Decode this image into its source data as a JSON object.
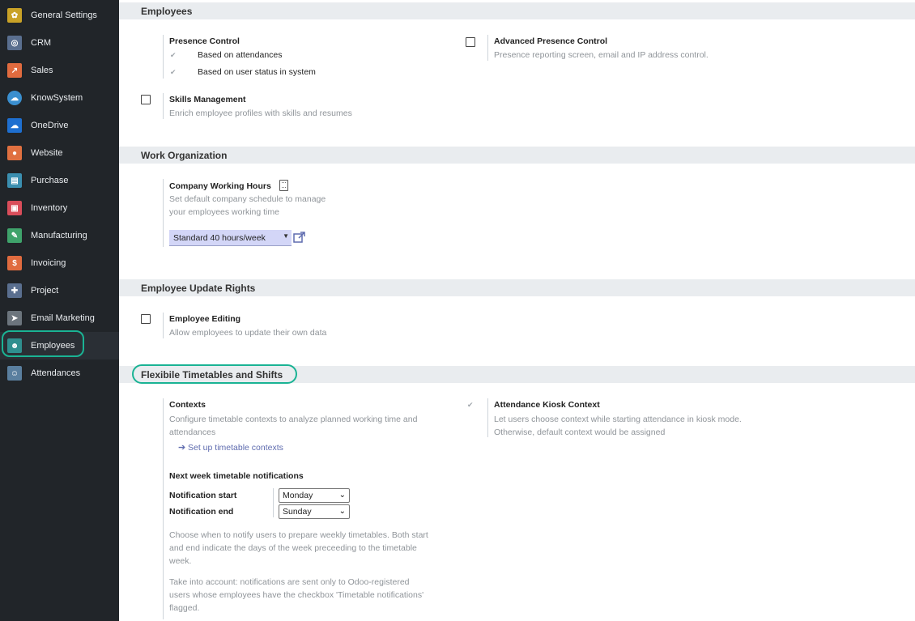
{
  "sidebar": {
    "items": [
      {
        "label": "General Settings",
        "icon": "gear-icon",
        "color": "#c9a227"
      },
      {
        "label": "CRM",
        "icon": "handshake-icon",
        "color": "#5a6f8f"
      },
      {
        "label": "Sales",
        "icon": "chart-icon",
        "color": "#e06b3f"
      },
      {
        "label": "KnowSystem",
        "icon": "cloud-icon",
        "color": "#3a8fcf"
      },
      {
        "label": "OneDrive",
        "icon": "onedrive-icon",
        "color": "#1e6fd0"
      },
      {
        "label": "Website",
        "icon": "globe-icon",
        "color": "#e07040"
      },
      {
        "label": "Purchase",
        "icon": "purchase-icon",
        "color": "#3b8fb0"
      },
      {
        "label": "Inventory",
        "icon": "inventory-icon",
        "color": "#d94d5a"
      },
      {
        "label": "Manufacturing",
        "icon": "wrench-icon",
        "color": "#3fa36b"
      },
      {
        "label": "Invoicing",
        "icon": "invoice-icon",
        "color": "#e06b3f"
      },
      {
        "label": "Project",
        "icon": "puzzle-icon",
        "color": "#5a6f8f"
      },
      {
        "label": "Email Marketing",
        "icon": "paper-plane-icon",
        "color": "#6c757d"
      },
      {
        "label": "Employees",
        "icon": "users-icon",
        "color": "#2f8f8f"
      },
      {
        "label": "Attendances",
        "icon": "attendance-icon",
        "color": "#5a7f9f"
      }
    ]
  },
  "sections": {
    "employees": "Employees",
    "work_org": "Work Organization",
    "update_rights": "Employee Update Rights",
    "flexible": "Flexibile Timetables and Shifts"
  },
  "presence": {
    "title": "Presence Control",
    "opt1": "Based on attendances",
    "opt2": "Based on user status in system"
  },
  "advanced_presence": {
    "title": "Advanced Presence Control",
    "desc": "Presence reporting screen, email and IP address control."
  },
  "skills": {
    "title": "Skills Management",
    "desc": "Enrich employee profiles with skills and resumes"
  },
  "working_hours": {
    "title": "Company Working Hours",
    "desc1": "Set default company schedule to manage",
    "desc2": "your employees working time",
    "value": "Standard 40 hours/week"
  },
  "editing": {
    "title": "Employee Editing",
    "desc": "Allow employees to update their own data"
  },
  "contexts": {
    "title": "Contexts",
    "desc1": "Configure timetable contexts to analyze planned working time and",
    "desc2": "attendances",
    "link": "Set up timetable contexts"
  },
  "kiosk": {
    "title": "Attendance Kiosk Context",
    "desc1": "Let users choose context while starting attendance in kiosk mode.",
    "desc2": "Otherwise, default context would be assigned"
  },
  "notifications": {
    "title": "Next week timetable notifications",
    "start_label": "Notification start",
    "start_value": "Monday",
    "end_label": "Notification end",
    "end_value": "Sunday",
    "help1": "Choose when to notify users to prepare weekly timetables. Both start",
    "help2": "and end indicate the days of the week preceeding to the timetable",
    "help3": "week.",
    "help4": "Take into account: notifications are sent only to Odoo-registered",
    "help5": "users whose employees have the checkbox 'Timetable notifications'",
    "help6": "flagged."
  },
  "colors": {
    "highlight": "#1ab394",
    "selected_field": "#d3d6f7"
  }
}
